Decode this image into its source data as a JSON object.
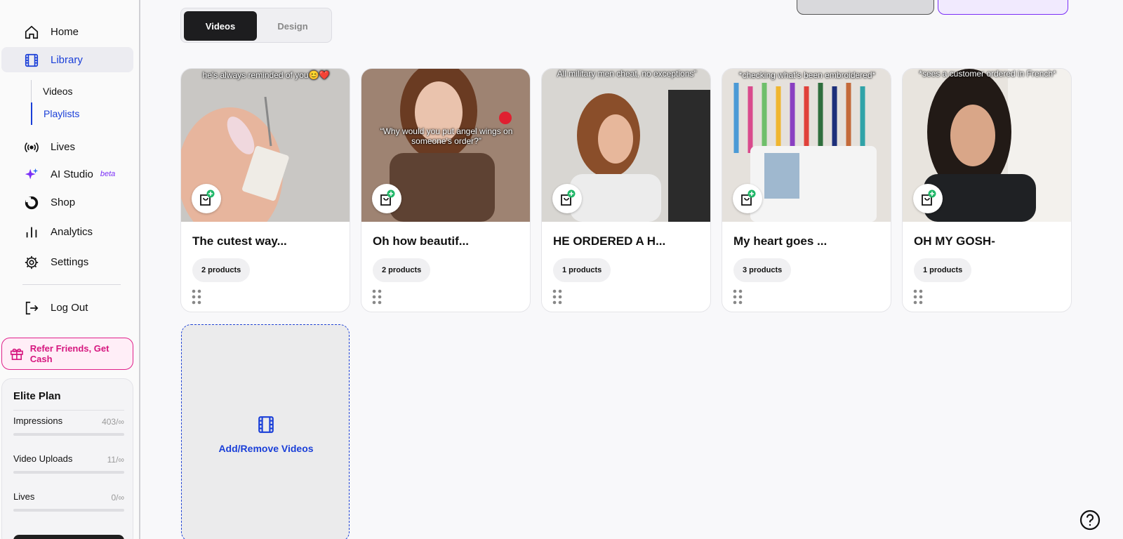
{
  "sidebar": {
    "nav": {
      "home": "Home",
      "library": "Library",
      "lives": "Lives",
      "ai_studio": "AI Studio",
      "ai_badge": "beta",
      "shop": "Shop",
      "analytics": "Analytics",
      "settings": "Settings",
      "logout": "Log Out"
    },
    "library_sub": {
      "videos": "Videos",
      "playlists": "Playlists"
    },
    "refer": "Refer Friends, Get Cash",
    "plan": {
      "title": "Elite Plan",
      "usage": [
        {
          "label": "Impressions",
          "value": "403/∞"
        },
        {
          "label": "Video Uploads",
          "value": "11/∞"
        },
        {
          "label": "Lives",
          "value": "0/∞"
        }
      ]
    }
  },
  "tabs": {
    "videos": "Videos",
    "design": "Design"
  },
  "cards": [
    {
      "title": "The cutest way...",
      "products": "2 products",
      "caption": "he's always reminded of you😊❤️"
    },
    {
      "title": "Oh how beautif...",
      "products": "2 products",
      "caption": "“Why would you put angel wings on someone's order?”"
    },
    {
      "title": "HE ORDERED A H...",
      "products": "1 products",
      "caption": "All military men cheat, no exceptions”"
    },
    {
      "title": "My heart goes ...",
      "products": "3 products",
      "caption": "*checking what's been embroidered*"
    },
    {
      "title": "OH MY GOSH-",
      "products": "1 products",
      "caption": "*sees a customer ordered in French*"
    }
  ],
  "add_tile": {
    "label": "Add/Remove Videos"
  },
  "icons": {
    "home": "home-icon",
    "library": "film-icon",
    "lives": "broadcast-icon",
    "ai": "sparkle-icon",
    "shop": "shop-logo-icon",
    "analytics": "bar-chart-icon",
    "settings": "gear-icon",
    "logout": "logout-icon",
    "refer": "gift-icon",
    "shop_add": "shopping-bag-plus-icon",
    "drag": "drag-handle-icon",
    "help": "help-icon"
  },
  "colors": {
    "accent": "#1a3fd8",
    "pink": "#d6177f",
    "purple": "#7b2ff7",
    "green": "#22b86a"
  }
}
